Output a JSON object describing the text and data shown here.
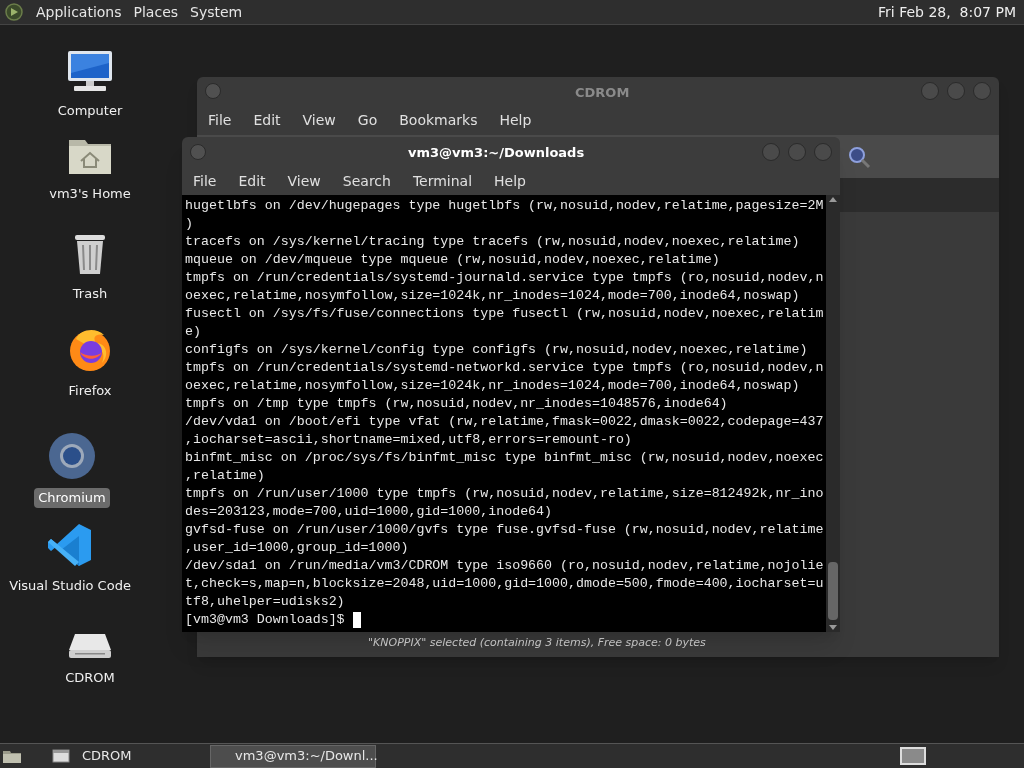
{
  "top_panel": {
    "menus": [
      "Applications",
      "Places",
      "System"
    ],
    "clock": "Fri Feb 28,  8:07 PM"
  },
  "desktop_icons": [
    {
      "kind": "computer",
      "label": "Computer",
      "selected": false
    },
    {
      "kind": "home",
      "label": "vm3's Home",
      "selected": false
    },
    {
      "kind": "trash",
      "label": "Trash",
      "selected": false
    },
    {
      "kind": "firefox",
      "label": "Firefox",
      "selected": false
    },
    {
      "kind": "chromium",
      "label": "Chromium",
      "selected": true
    },
    {
      "kind": "vscode",
      "label": "Visual Studio Code",
      "selected": false
    },
    {
      "kind": "drive",
      "label": "CDROM",
      "selected": false
    }
  ],
  "file_manager": {
    "title": "CDROM",
    "menu": [
      "File",
      "Edit",
      "View",
      "Go",
      "Bookmarks",
      "Help"
    ],
    "status": "\"KNOPPIX\" selected (containing 3 items), Free space: 0 bytes"
  },
  "terminal": {
    "title": "vm3@vm3:~/Downloads",
    "menu": [
      "File",
      "Edit",
      "View",
      "Search",
      "Terminal",
      "Help"
    ],
    "lines": [
      "hugetlbfs on /dev/hugepages type hugetlbfs (rw,nosuid,nodev,relatime,pagesize=2M",
      ")",
      "tracefs on /sys/kernel/tracing type tracefs (rw,nosuid,nodev,noexec,relatime)",
      "mqueue on /dev/mqueue type mqueue (rw,nosuid,nodev,noexec,relatime)",
      "tmpfs on /run/credentials/systemd-journald.service type tmpfs (ro,nosuid,nodev,n",
      "oexec,relatime,nosymfollow,size=1024k,nr_inodes=1024,mode=700,inode64,noswap)",
      "fusectl on /sys/fs/fuse/connections type fusectl (rw,nosuid,nodev,noexec,relatim",
      "e)",
      "configfs on /sys/kernel/config type configfs (rw,nosuid,nodev,noexec,relatime)",
      "tmpfs on /run/credentials/systemd-networkd.service type tmpfs (ro,nosuid,nodev,n",
      "oexec,relatime,nosymfollow,size=1024k,nr_inodes=1024,mode=700,inode64,noswap)",
      "tmpfs on /tmp type tmpfs (rw,nosuid,nodev,nr_inodes=1048576,inode64)",
      "/dev/vda1 on /boot/efi type vfat (rw,relatime,fmask=0022,dmask=0022,codepage=437",
      ",iocharset=ascii,shortname=mixed,utf8,errors=remount-ro)",
      "binfmt_misc on /proc/sys/fs/binfmt_misc type binfmt_misc (rw,nosuid,nodev,noexec",
      ",relatime)",
      "tmpfs on /run/user/1000 type tmpfs (rw,nosuid,nodev,relatime,size=812492k,nr_ino",
      "des=203123,mode=700,uid=1000,gid=1000,inode64)",
      "gvfsd-fuse on /run/user/1000/gvfs type fuse.gvfsd-fuse (rw,nosuid,nodev,relatime",
      ",user_id=1000,group_id=1000)",
      "/dev/sda1 on /run/media/vm3/CDROM type iso9660 (ro,nosuid,nodev,relatime,nojolie",
      "t,check=s,map=n,blocksize=2048,uid=1000,gid=1000,dmode=500,fmode=400,iocharset=u",
      "tf8,uhelper=udisks2)"
    ],
    "prompt": "[vm3@vm3 Downloads]$"
  },
  "taskbar": [
    {
      "label": "CDROM",
      "selected": false
    },
    {
      "label": "vm3@vm3:~/Downl...",
      "selected": true
    }
  ]
}
